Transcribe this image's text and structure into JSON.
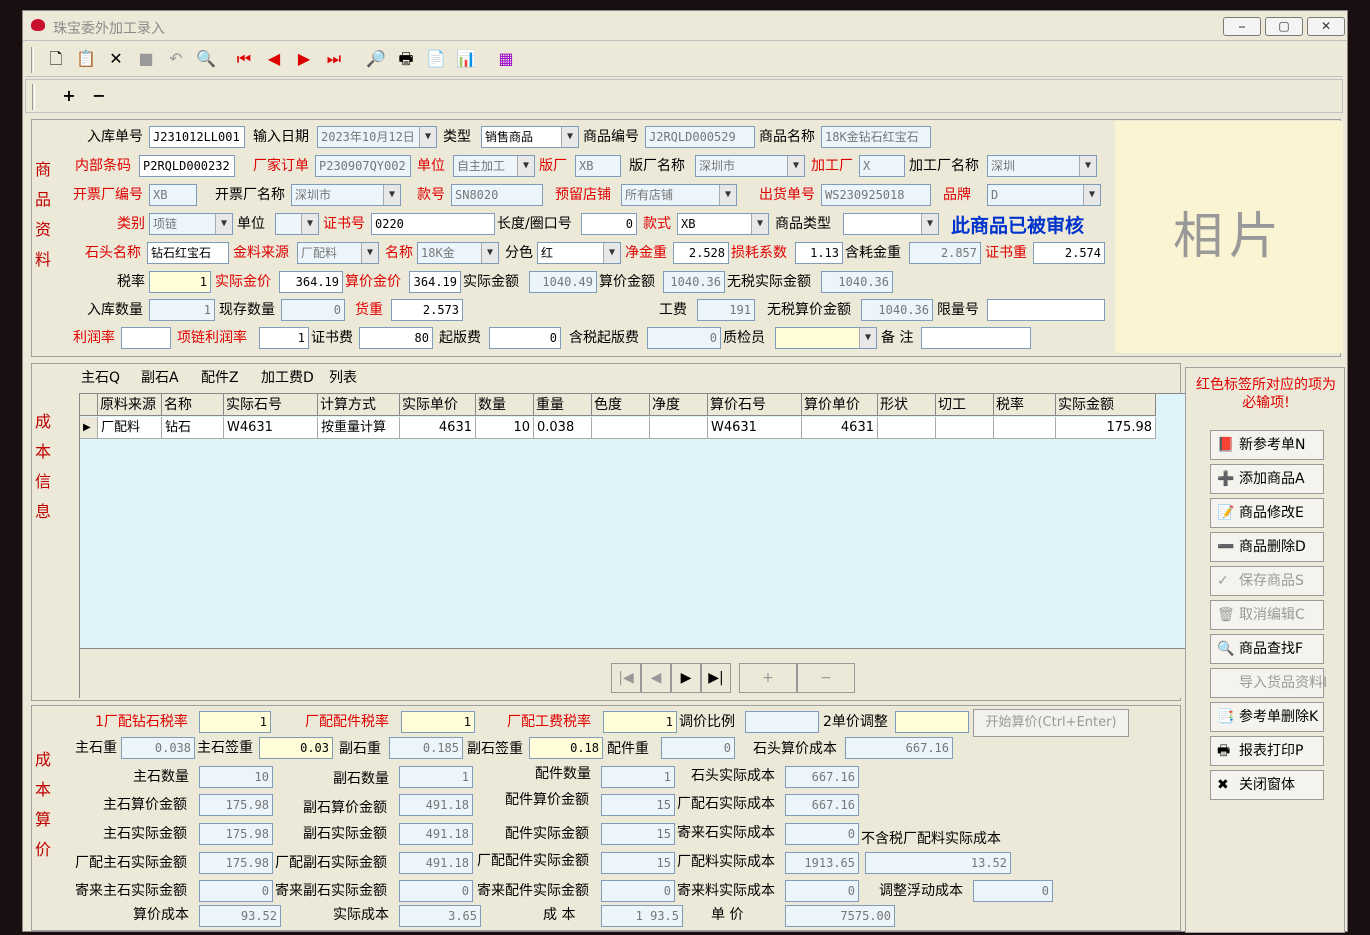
{
  "window": {
    "title": "珠宝委外加工录入",
    "min": "⎯",
    "max": "▢",
    "close": "✕"
  },
  "toolbar": [
    "🗋",
    "📋",
    "✕",
    "■",
    "↶",
    "🔍",
    "⏮",
    "◀",
    "▶",
    "⏭",
    "🔎",
    "🖶",
    "📄",
    "📊",
    "▦"
  ],
  "toolbar2": [
    "+",
    "−"
  ],
  "photo": "相片",
  "notice": "此商品已被审核",
  "left_sections": {
    "info": "商品资料",
    "cost_info": "成本信息",
    "cost_calc": "成本算价"
  },
  "form": {
    "in_no_label": "入库单号",
    "in_no": "J231012LL001",
    "date_label": "输入日期",
    "date": "2023年10月12日",
    "type_label": "类型",
    "type": "销售商品",
    "code_label": "商品编号",
    "code": "J2RQLD000529",
    "name_label": "商品名称",
    "name": "18K金钻石红宝石",
    "barcode_label": "内部条码",
    "barcode": "P2RQLD000232",
    "factory_order_label": "厂家订单",
    "factory_order": "P230907QY002",
    "unit_label": "单位",
    "unit": "自主加工",
    "ver_label": "版厂",
    "ver": "XB",
    "ver_name_label": "版厂名称",
    "ver_name": "深圳市",
    "proc_label": "加工厂",
    "proc": "X",
    "proc_name_label": "加工厂名称",
    "proc_name": "深圳",
    "inv_no_label": "开票厂编号",
    "inv_no": "XB",
    "inv_name_label": "开票厂名称",
    "inv_name": "深圳市",
    "style_label": "款号",
    "style": "SN8020",
    "store_label": "预留店铺",
    "store": "所有店铺",
    "out_no_label": "出货单号",
    "out_no": "WS230925018",
    "brand_label": "品牌",
    "brand": "D",
    "cat_label": "类别",
    "cat": "项链",
    "unit2_label": "单位",
    "unit2": "",
    "cert_label": "证书号",
    "cert": "0220",
    "len_label": "长度/圈口号",
    "len": "0",
    "kind_label": "款式",
    "kind": "XB",
    "ptype_label": "商品类型",
    "ptype": "",
    "stone_label": "石头名称",
    "stone": "钻石红宝石",
    "src_label": "金料来源",
    "src": "厂配料",
    "mname_label": "名称",
    "mname": "18K金",
    "color_label": "分色",
    "color": "红",
    "net_label": "净金重",
    "net": "2.528",
    "loss_label": "损耗系数",
    "loss": "1.13",
    "gold_label": "含耗金重",
    "gold": "2.857",
    "certw_label": "证书重",
    "certw": "2.574",
    "tax_label": "税率",
    "tax": "1",
    "actual_gp_label": "实际金价",
    "actual_gp": "364.19",
    "calc_gp_label": "算价金价",
    "calc_gp": "364.19",
    "actual_amt_label": "实际金额",
    "actual_amt": "1040.49",
    "calc_amt_label": "算价金额",
    "calc_amt": "1040.36",
    "notax_label": "无税实际金额",
    "notax": "1040.36",
    "qty_label": "入库数量",
    "qty": "1",
    "stock_label": "现存数量",
    "stock": "0",
    "weight_label": "货重",
    "weight": "2.573",
    "labor_label": "工费",
    "labor": "191",
    "notax_calc_label": "无税算价金额",
    "notax_calc": "1040.36",
    "limit_label": "限量号",
    "limit": "",
    "profit_label": "利润率",
    "profit": "",
    "chain_label": "项链利润率",
    "chain": "1",
    "certfee_label": "证书费",
    "certfee": "80",
    "minfee_label": "起版费",
    "minfee": "0",
    "taxmin_label": "含税起版费",
    "taxmin": "0",
    "qc_label": "质检员",
    "qc": "",
    "memo_label": "备 注",
    "memo": ""
  },
  "tabs": [
    "主石Q",
    "副石A",
    "配件Z",
    "加工费D",
    "列表"
  ],
  "grid": {
    "headers": [
      "原料来源",
      "名称",
      "实际石号",
      "计算方式",
      "实际单价",
      "数量",
      "重量",
      "色度",
      "净度",
      "算价石号",
      "算价单价",
      "形状",
      "切工",
      "税率",
      "实际金额"
    ],
    "row": [
      "厂配料",
      "钻石",
      "W4631",
      "按重量计算",
      "4631",
      "10",
      "0.038",
      "",
      "",
      "W4631",
      "4631",
      "",
      "",
      "",
      "175.98"
    ]
  },
  "nav": [
    "|◀",
    "◀",
    "▶",
    "▶|",
    "+",
    "−"
  ],
  "side": {
    "hint": "红色标签所对应的项为必输项!",
    "buttons": [
      {
        "icon": "📕",
        "label": "新参考单N"
      },
      {
        "icon": "➕",
        "label": "添加商品A"
      },
      {
        "icon": "📝",
        "label": "商品修改E"
      },
      {
        "icon": "➖",
        "label": "商品删除D"
      },
      {
        "icon": "✓",
        "label": "保存商品S"
      },
      {
        "icon": "🗑",
        "label": "取消编辑C"
      },
      {
        "icon": "🔍",
        "label": "商品查找F"
      },
      {
        "icon": "",
        "label": "导入货品资料I"
      },
      {
        "icon": "📑",
        "label": "参考单删除K"
      },
      {
        "icon": "🖶",
        "label": "报表打印P"
      },
      {
        "icon": "✖",
        "label": "关闭窗体"
      }
    ]
  },
  "calc": {
    "r1": "1厂配钻石税率",
    "r1v": "1",
    "r2": "厂配配件税率",
    "r2v": "1",
    "r3": "厂配工费税率",
    "r3v": "1",
    "adj_label": "调价比例",
    "adj": "",
    "adj2_label": "2单价调整",
    "adj2": "",
    "start": "开始算价(Ctrl+Enter)",
    "mw_label": "主石重",
    "mw": "0.038",
    "mws_label": "主石签重",
    "mws": "0.03",
    "sw_label": "副石重",
    "sw": "0.185",
    "sws_label": "副石签重",
    "sws": "0.18",
    "pw_label": "配件重",
    "pw": "0",
    "scost_label": "石头算价成本",
    "scost": "667.16",
    "mq_label": "主石数量",
    "mq": "10",
    "sq_label": "副石数量",
    "sq": "1",
    "pq_label": "配件数量",
    "pq": "1",
    "sac_label": "石头实际成本",
    "sac": "667.16",
    "mca_label": "主石算价金额",
    "mca": "175.98",
    "sca_label": "副石算价金额",
    "sca": "491.18",
    "pca_label": "配件算价金额",
    "pca": "15",
    "fsc_label": "厂配石实际成本",
    "fsc": "667.16",
    "maa_label": "主石实际金额",
    "maa": "175.98",
    "saa_label": "副石实际金额",
    "saa": "491.18",
    "paa_label": "配件实际金额",
    "paa": "15",
    "jsc_label": "寄来石实际成本",
    "jsc": "0",
    "ntx_label": "不含税厂配料实际成本",
    "fma_label": "厂配主石实际金额",
    "fma": "175.98",
    "fsa_label": "厂配副石实际金额",
    "fsa": "491.18",
    "fpa_label": "厂配配件实际金额",
    "fpa": "15",
    "fmc_label": "厂配料实际成本",
    "fmc": "1913.65",
    "ntx": "13.52",
    "jma_label": "寄来主石实际金额",
    "jma": "0",
    "jsa_label": "寄来副石实际金额",
    "jsa": "0",
    "jpa_label": "寄来配件实际金额",
    "jpa": "0",
    "jmc_label": "寄来料实际成本",
    "jmc": "0",
    "float_label": "调整浮动成本",
    "float": "0",
    "cc_label": "算价成本",
    "cc": "93.52",
    "ac_label": "实际成本",
    "ac": "3.65",
    "cost_label": "成 本",
    "cost": "1 93.5",
    "price_label": "单 价",
    "price": "7575.00"
  }
}
